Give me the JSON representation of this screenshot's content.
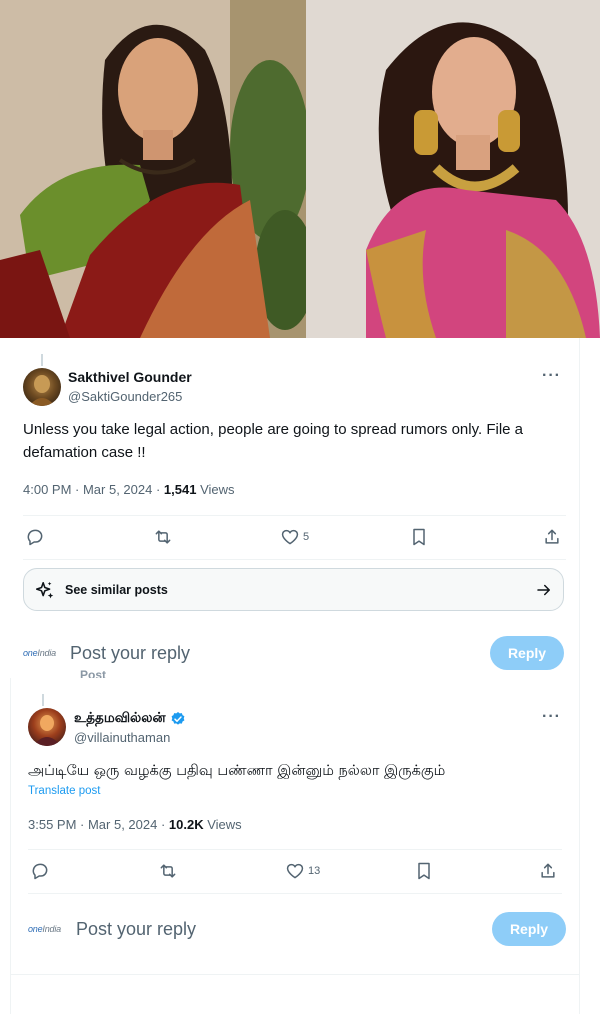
{
  "photos": {
    "left_alt": "woman in red saree with green blouse",
    "right_alt": "woman in pink silk saree with gold jewelry"
  },
  "tweet1": {
    "display_name": "Sakthivel Gounder",
    "handle": "@SaktiGounder265",
    "more": "···",
    "text": "Unless you take legal action, people are going to spread rumors only. File a defamation case !!",
    "time": "4:00 PM · Mar 5, 2024 · ",
    "views_count": "1,541",
    "views_label": " Views",
    "likes": "5",
    "see_similar": "See similar posts",
    "reply_placeholder": "Post your reply",
    "reply_button": "Reply",
    "ghost": "Post"
  },
  "tweet2": {
    "display_name": "உத்தமவில்லன்",
    "handle": "@villainuthaman",
    "more": "···",
    "text": "அப்டியே ஒரு வழக்கு பதிவு பண்ணா இன்னும் நல்லா இருக்கும்",
    "translate": "Translate post",
    "time": "3:55 PM · Mar 5, 2024 · ",
    "views_count": "10.2K",
    "views_label": " Views",
    "likes": "13",
    "reply_placeholder": "Post your reply",
    "reply_button": "Reply"
  },
  "brand": {
    "one": "one",
    "india": "India"
  },
  "colors": {
    "accent": "#1d9bf0",
    "reply_button_disabled": "#8ecdf8",
    "text_primary": "#0f1419",
    "text_secondary": "#536471"
  },
  "icons": [
    "reply-icon",
    "repost-icon",
    "like-icon",
    "bookmark-icon",
    "share-icon",
    "sparkle-icon",
    "arrow-right-icon",
    "verified-badge-icon",
    "more-icon"
  ]
}
